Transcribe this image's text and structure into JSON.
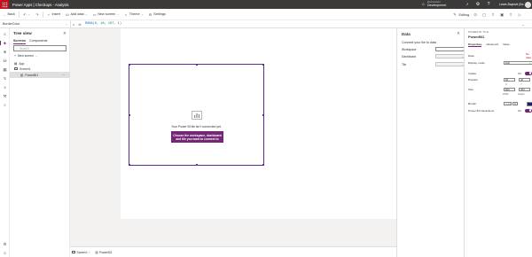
{
  "header": {
    "title": "Power Apps  |  Checkups - Analysis",
    "environment_label": "Environment",
    "environment_name": "Development",
    "user_name": "Lewis Baybutt (Se...",
    "icons": [
      "environment-icon",
      "bell-icon",
      "gear-icon",
      "help-icon"
    ]
  },
  "commandbar": {
    "back": "Back",
    "insert": "Insert",
    "add_data": "Add data",
    "new_screen": "New screen",
    "theme": "Theme",
    "settings": "Settings",
    "editing": "Editing"
  },
  "formula_bar": {
    "property": "BorderColor",
    "equals": "=",
    "fx": "fx",
    "formula_fn": "RGBA(",
    "formula_args": "0, 18, 107, 1",
    "formula_close": ")"
  },
  "tree_view": {
    "title": "Tree view",
    "tabs": [
      "Screens",
      "Components"
    ],
    "search_placeholder": "Search",
    "new_screen": "New screen",
    "items": [
      "App",
      "Screen1",
      "PowerBI1"
    ]
  },
  "canvas": {
    "message": "Your Power BI tile isn't connected yet.",
    "button_label": "Choose the workspace, dashboard and tile you want to connect to"
  },
  "bottom_bar": {
    "crumbs": [
      "Screen1",
      "PowerBI1"
    ]
  },
  "data_panel": {
    "title": "Data",
    "subtitle": "Connect your tile to data",
    "rows": [
      {
        "label": "Workspace",
        "value": "⌄"
      },
      {
        "label": "Dashboard",
        "value": "⌄"
      },
      {
        "label": "Tile",
        "value": "⌄"
      }
    ]
  },
  "properties": {
    "type_label": "POWER BI TILE",
    "name": "PowerBI1",
    "tabs": [
      "Properties",
      "Advanced",
      "Ideas"
    ],
    "data_label": "Data",
    "data_link": "No data",
    "display_mode_label": "Display mode",
    "display_mode_value": "Edit",
    "visible_label": "Visible",
    "visible_value": "On",
    "position_label": "Position",
    "position_x": "60",
    "position_y": "40",
    "x_label": "X",
    "y_label": "Y",
    "size_label": "Size",
    "size_w": "600",
    "size_h": "400",
    "width_label": "Width",
    "height_label": "Height",
    "border_label": "Border",
    "border_value": "0",
    "border_style": "Solid",
    "power_bi_label": "Power BI interactions",
    "power_bi_value": "On",
    "border_color": "#1a1a7a",
    "accent": "#742774"
  }
}
